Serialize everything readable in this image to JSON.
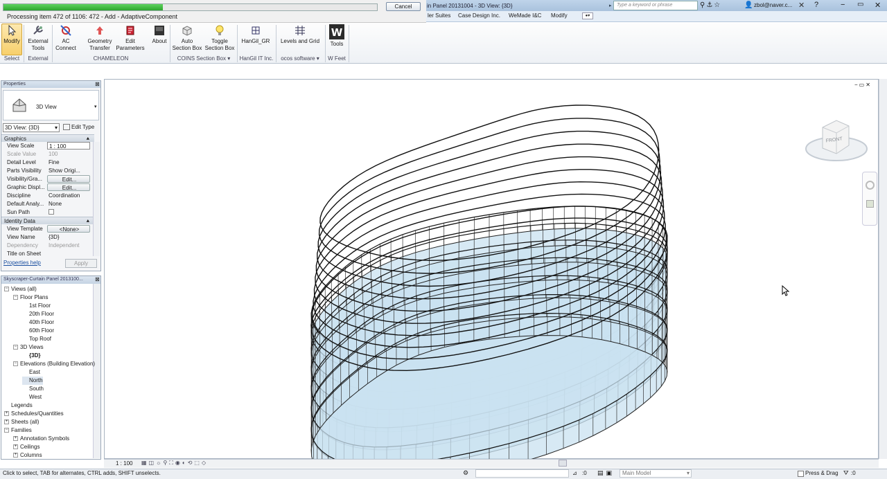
{
  "progress": {
    "text": "Processing item 472 of 1106: 472 - Add - AdaptiveComponent",
    "fraction": 0.427,
    "cancel_label": "Cancel"
  },
  "window": {
    "title": "in Panel 20131004 - 3D View: {3D}",
    "search_placeholder": "Type a keyword or phrase",
    "user": "zbol@naver.c..."
  },
  "menu": [
    "ler Suites",
    "Case Design Inc.",
    "WeMade I&C",
    "Modify"
  ],
  "ribbon": {
    "buttons": [
      {
        "label": "Modify",
        "label2": ""
      },
      {
        "label": "External",
        "label2": "Tools"
      },
      {
        "label": "AC",
        "label2": "Connect"
      },
      {
        "label": "Geometry",
        "label2": "Transfer"
      },
      {
        "label": "Edit",
        "label2": "Parameters"
      },
      {
        "label": "About",
        "label2": ""
      },
      {
        "label": "Auto",
        "label2": "Section Box"
      },
      {
        "label": "Toggle",
        "label2": "Section Box"
      },
      {
        "label": "HanGil_GR",
        "label2": ""
      },
      {
        "label": "Levels and Grid",
        "label2": ""
      },
      {
        "label": "Tools",
        "label2": ""
      }
    ],
    "panels": [
      "Select",
      "External",
      "CHAMELEON",
      "COINS Section Box ▾",
      "HanGil IT Inc.",
      "ocos software ▾",
      "W Feet"
    ]
  },
  "properties": {
    "title": "Properties",
    "type_name": "3D View",
    "selector": "3D View: {3D}",
    "edit_type": "Edit Type",
    "sections": {
      "graphics": "Graphics",
      "identity": "Identity Data"
    },
    "rows": [
      {
        "k": "View Scale",
        "v": "1 : 100"
      },
      {
        "k": "Scale Value",
        "v": "100"
      },
      {
        "k": "Detail Level",
        "v": "Fine"
      },
      {
        "k": "Parts Visibility",
        "v": "Show Origi..."
      },
      {
        "k": "Visibility/Gra...",
        "v": "Edit..."
      },
      {
        "k": "Graphic Displ...",
        "v": "Edit..."
      },
      {
        "k": "Discipline",
        "v": "Coordination"
      },
      {
        "k": "Default Analy...",
        "v": "None"
      },
      {
        "k": "Sun Path",
        "v": ""
      },
      {
        "k": "View Template",
        "v": "<None>"
      },
      {
        "k": "View Name",
        "v": "{3D}"
      },
      {
        "k": "Dependency",
        "v": "Independent"
      },
      {
        "k": "Title on Sheet",
        "v": ""
      }
    ],
    "help": "Properties help",
    "apply": "Apply"
  },
  "browser": {
    "title": "Skyscraper-Curtain Panel 2013100...",
    "items": [
      {
        "label": "Views (all)",
        "level": 0,
        "toggle": "−"
      },
      {
        "label": "Floor Plans",
        "level": 1,
        "toggle": "−"
      },
      {
        "label": "1st Floor",
        "level": 2,
        "toggle": ""
      },
      {
        "label": "20th Floor",
        "level": 2,
        "toggle": ""
      },
      {
        "label": "40th Floor",
        "level": 2,
        "toggle": ""
      },
      {
        "label": "60th Floor",
        "level": 2,
        "toggle": ""
      },
      {
        "label": "Top Roof",
        "level": 2,
        "toggle": ""
      },
      {
        "label": "3D Views",
        "level": 1,
        "toggle": "−"
      },
      {
        "label": "{3D}",
        "level": 2,
        "toggle": ""
      },
      {
        "label": "Elevations (Building Elevation)",
        "level": 1,
        "toggle": "−"
      },
      {
        "label": "East",
        "level": 2,
        "toggle": ""
      },
      {
        "label": "North",
        "level": 2,
        "toggle": ""
      },
      {
        "label": "South",
        "level": 2,
        "toggle": ""
      },
      {
        "label": "West",
        "level": 2,
        "toggle": ""
      },
      {
        "label": "Legends",
        "level": 0,
        "toggle": ""
      },
      {
        "label": "Schedules/Quantities",
        "level": 0,
        "toggle": "+"
      },
      {
        "label": "Sheets (all)",
        "level": 0,
        "toggle": "+"
      },
      {
        "label": "Families",
        "level": 0,
        "toggle": "−"
      },
      {
        "label": "Annotation Symbols",
        "level": 1,
        "toggle": "+"
      },
      {
        "label": "Ceilings",
        "level": 1,
        "toggle": "+"
      },
      {
        "label": "Columns",
        "level": 1,
        "toggle": "+"
      }
    ]
  },
  "viewcube": {
    "face": "FRONT"
  },
  "view_controls": {
    "scale": "1 : 100"
  },
  "status": {
    "text": "Click to select, TAB for alternates, CTRL adds, SHIFT unselects.",
    "coord": ":0",
    "model": "Main Model",
    "press_drag": "Press & Drag",
    "filter": ":0"
  },
  "colors": {
    "glass": "#c9e2f0",
    "accent": "#2ea52e"
  }
}
